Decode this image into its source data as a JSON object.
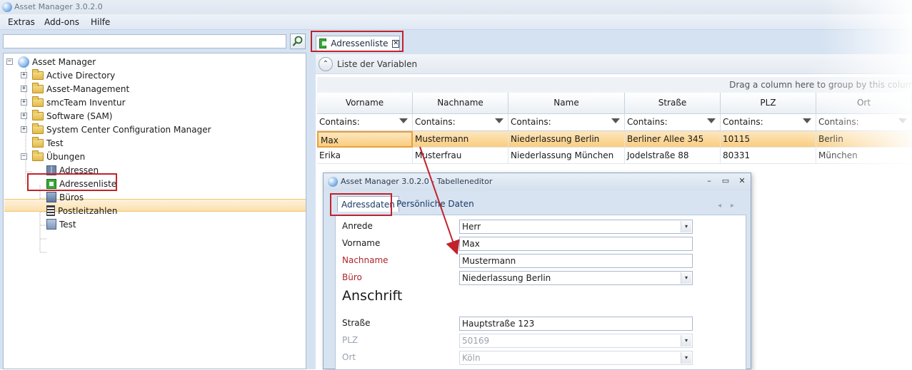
{
  "window": {
    "title": "Asset Manager 3.0.2.0"
  },
  "menu": {
    "items": [
      "Extras",
      "Add-ons",
      "Hilfe"
    ]
  },
  "search": {
    "value": "",
    "placeholder": ""
  },
  "tree": {
    "root": "Asset Manager",
    "folders": [
      "Active Directory",
      "Asset-Management",
      "smcTeam Inventur",
      "Software (SAM)",
      "System Center Configuration Manager",
      "Test",
      "Übungen"
    ],
    "children": [
      "Adressen",
      "Adressenliste",
      "Büros",
      "Postleitzahlen",
      "Test"
    ]
  },
  "tab": {
    "label": "Adressenliste",
    "close": "✕"
  },
  "variables_bar": {
    "label": "Liste der Variablen",
    "toggle_icon": "chevron-up-icon"
  },
  "grid": {
    "group_hint": "Drag a column here to group by this column",
    "columns": [
      "Vorname",
      "Nachname",
      "Name",
      "Straße",
      "PLZ",
      "Ort"
    ],
    "filter_label": "Contains:",
    "rows": [
      [
        "Max",
        "Mustermann",
        "Niederlassung Berlin",
        "Berliner Allee 345",
        "10115",
        "Berlin"
      ],
      [
        "Erika",
        "Musterfrau",
        "Niederlassung München",
        "Jodelstraße 88",
        "80331",
        "München"
      ]
    ]
  },
  "dialog": {
    "title": "Asset Manager 3.0.2.0 - Tabelleneditor",
    "tabs": [
      "Adressdaten",
      "Persönliche Daten"
    ],
    "fields": {
      "anrede": {
        "label": "Anrede",
        "value": "Herr"
      },
      "vorname": {
        "label": "Vorname",
        "value": "Max"
      },
      "nachname": {
        "label": "Nachname",
        "value": "Mustermann"
      },
      "buero": {
        "label": "Büro",
        "value": "Niederlassung Berlin"
      }
    },
    "section": "Anschrift",
    "address": {
      "strasse": {
        "label": "Straße",
        "value": "Hauptstraße 123"
      },
      "plz": {
        "label": "PLZ",
        "value": "50169"
      },
      "ort": {
        "label": "Ort",
        "value": "Köln"
      }
    }
  },
  "colors": {
    "highlight": "#c0232b",
    "selection": "#f9cd7f",
    "panel": "#d5e2f1"
  }
}
